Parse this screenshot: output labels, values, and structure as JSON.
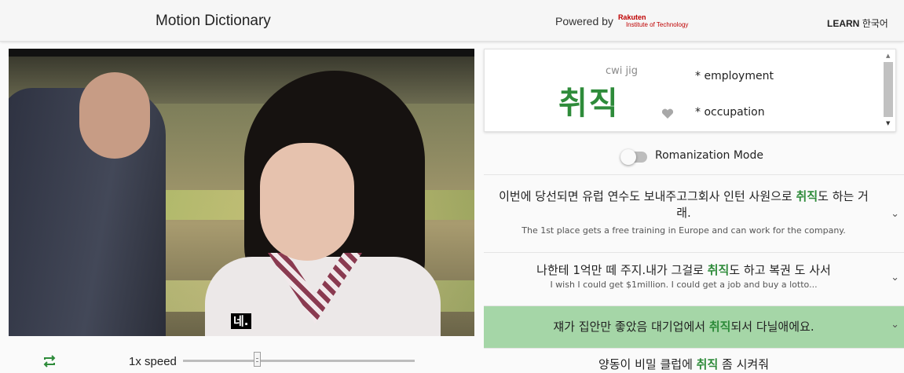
{
  "header": {
    "app_title": "Motion Dictionary",
    "powered_by": "Powered by",
    "logo_line1": "Rakuten",
    "logo_line2": "Institute of Technology",
    "learn_bold": "LEARN",
    "learn_lang": "한국어"
  },
  "video": {
    "subtitle": "네."
  },
  "controls": {
    "speed_label": "1x speed",
    "speed_fraction": 0.32
  },
  "word_card": {
    "romanization": "cwi jig",
    "word": "취직",
    "definitions": [
      "* employment",
      "* occupation"
    ]
  },
  "toggle": {
    "label": "Romanization Mode",
    "enabled": false
  },
  "sentences": [
    {
      "ko_pre": "이번에 당선되면 유럽 연수도 보내주고그회사 인턴 사원으로 ",
      "ko_hl": "취직",
      "ko_post": "도 하는 거래.",
      "en": "The 1st place gets a free training in Europe and can work for the company.",
      "active": false
    },
    {
      "ko_pre": "나한테 1억만 떼 주지.내가 그걸로 ",
      "ko_hl": "취직",
      "ko_post": "도 하고 복권 도 사서",
      "en": "I wish I could get $1million. I could get a job and buy a lotto...",
      "active": false
    },
    {
      "ko_pre": "쟤가 집안만 좋았음 대기업에서 ",
      "ko_hl": "취직",
      "ko_post": "되서 다닐애에요.",
      "en": "",
      "active": true
    },
    {
      "ko_pre": "양동이 비밀 클럽에 ",
      "ko_hl": "취직",
      "ko_post": " 좀 시켜줘",
      "en": "",
      "active": false
    }
  ],
  "colors": {
    "accent_green": "#2e8b3a",
    "active_row": "#a5d6a7"
  }
}
